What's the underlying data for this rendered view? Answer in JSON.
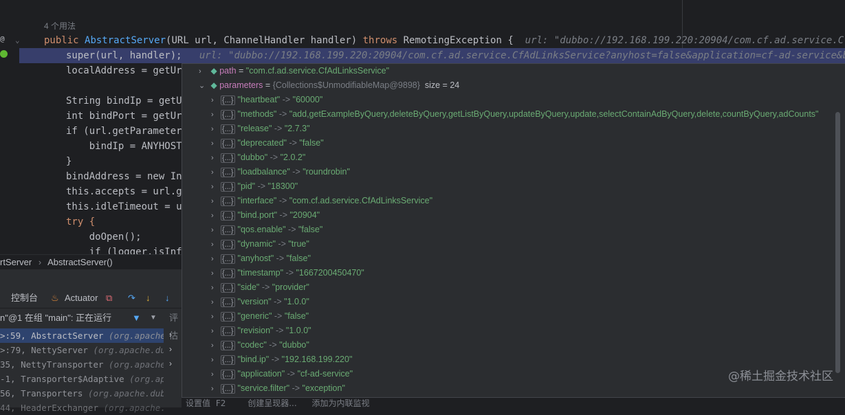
{
  "editor": {
    "usage_hint": "4 个用法",
    "constructor_sig": {
      "public": "public ",
      "name": "AbstractServer",
      "params": "(URL url, ChannelHandler handler) ",
      "throws": "throws ",
      "exc": "RemotingException {",
      "hint": "url: \"dubbo://192.168.199.220:20904/com.cf.ad.service.CfAdLink"
    },
    "lines": [
      {
        "code": "super(url, handler);",
        "hint": "url: \"dubbo://192.168.199.220:20904/com.cf.ad.service.CfAdLinksService?anyhost=false&application=cf-ad-service&bean.nam"
      },
      {
        "code": "localAddress = getUrl"
      },
      {
        "code": ""
      },
      {
        "code": "String bindIp = getUr"
      },
      {
        "code": "int bindPort = getUrl"
      },
      {
        "code": "if (url.getParameter("
      },
      {
        "code": "    bindIp = ANYHOST_"
      },
      {
        "code": "}"
      },
      {
        "code": "bindAddress = new Ine"
      },
      {
        "code": "this.accepts = url.ge"
      },
      {
        "code": "this.idleTimeout = ur"
      },
      {
        "code": "try {"
      },
      {
        "code": "    doOpen();"
      },
      {
        "code": "    if (logger.isInfo"
      }
    ]
  },
  "breadcrumb": {
    "left": "rtServer",
    "sep": "›",
    "right": "AbstractServer()"
  },
  "debug": {
    "tab_console": "控制台",
    "tab_actuator": "Actuator",
    "thread_status": "n\"@1 在组 \"main\": 正在运行",
    "eval_placeholder": "评估",
    "frames": [
      {
        "loc": ">:59, AbstractServer",
        "pkg": "(org.apache.dubbo."
      },
      {
        "loc": ">:79, NettyServer",
        "pkg": "(org.apache.dubbo.rem"
      },
      {
        "loc": "35, NettyTransporter",
        "pkg": "(org.apache.dubbo"
      },
      {
        "loc": "-1, Transporter$Adaptive",
        "pkg": "(org.apache.du"
      },
      {
        "loc": "56, Transporters",
        "pkg": "(org.apache.dubbo.re"
      },
      {
        "loc": "44, HeaderExchanger",
        "pkg": "(org.apache.dubbo"
      }
    ]
  },
  "popup": {
    "path": {
      "key": "path",
      "eq": " = ",
      "value": "\"com.cf.ad.service.CfAdLinksService\""
    },
    "parameters": {
      "key": "parameters",
      "eq": " = ",
      "type": "{Collections$UnmodifiableMap@9898}",
      "size": "size = 24"
    },
    "entries": [
      {
        "k": "\"heartbeat\"",
        "v": "\"60000\""
      },
      {
        "k": "\"methods\"",
        "v": "\"add,getExampleByQuery,deleteByQuery,getListByQuery,updateByQuery,update,selectContainAdByQuery,delete,countByQuery,adCounts\""
      },
      {
        "k": "\"release\"",
        "v": "\"2.7.3\""
      },
      {
        "k": "\"deprecated\"",
        "v": "\"false\""
      },
      {
        "k": "\"dubbo\"",
        "v": "\"2.0.2\""
      },
      {
        "k": "\"loadbalance\"",
        "v": "\"roundrobin\""
      },
      {
        "k": "\"pid\"",
        "v": "\"18300\""
      },
      {
        "k": "\"interface\"",
        "v": "\"com.cf.ad.service.CfAdLinksService\""
      },
      {
        "k": "\"bind.port\"",
        "v": "\"20904\""
      },
      {
        "k": "\"qos.enable\"",
        "v": "\"false\""
      },
      {
        "k": "\"dynamic\"",
        "v": "\"true\""
      },
      {
        "k": "\"anyhost\"",
        "v": "\"false\""
      },
      {
        "k": "\"timestamp\"",
        "v": "\"1667200450470\""
      },
      {
        "k": "\"side\"",
        "v": "\"provider\""
      },
      {
        "k": "\"version\"",
        "v": "\"1.0.0\""
      },
      {
        "k": "\"generic\"",
        "v": "\"false\""
      },
      {
        "k": "\"revision\"",
        "v": "\"1.0.0\""
      },
      {
        "k": "\"codec\"",
        "v": "\"dubbo\""
      },
      {
        "k": "\"bind.ip\"",
        "v": "\"192.168.199.220\""
      },
      {
        "k": "\"application\"",
        "v": "\"cf-ad-service\""
      },
      {
        "k": "\"service.filter\"",
        "v": "\"exception\""
      }
    ],
    "arrow": " -> ",
    "brace_label": "{...}"
  },
  "statusbar": {
    "a": "设置值",
    "a_key": "F2",
    "b": "创建呈现器...",
    "c": "添加为内联监视"
  },
  "watermark": "@稀土掘金技术社区"
}
